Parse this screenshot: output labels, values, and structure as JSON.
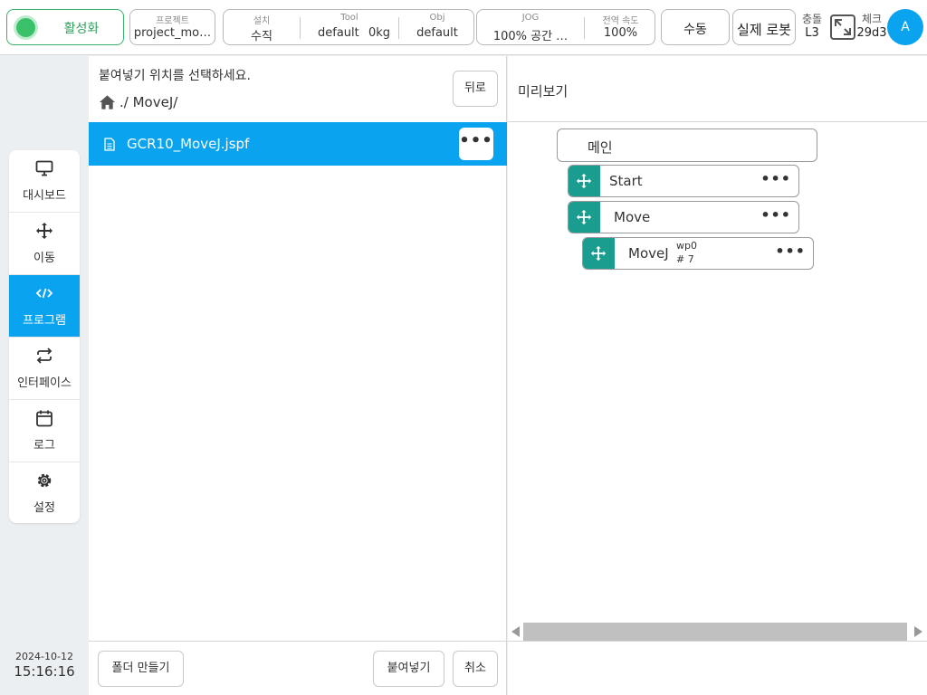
{
  "topbar": {
    "status_label": "활성화",
    "project": {
      "label": "프로젝트",
      "value": "project_mo…"
    },
    "install": {
      "label": "설치",
      "value": "수직"
    },
    "tool": {
      "label": "Tool",
      "value_name": "default",
      "value_weight": "0kg"
    },
    "obj": {
      "label": "Obj",
      "value": "default"
    },
    "jog": {
      "label": "JOG",
      "value": "100%  공간 …"
    },
    "global_speed": {
      "label": "전역 속도",
      "value": "100%"
    },
    "manual_label": "수동",
    "real_robot_label": "실제 로봇",
    "collision": {
      "label": "충돌",
      "value": "L3"
    },
    "check": {
      "label": "체크",
      "value": "29d3"
    },
    "avatar_letter": "A"
  },
  "sidenav": {
    "items": [
      {
        "label": "대시보드",
        "icon": "monitor-icon"
      },
      {
        "label": "이동",
        "icon": "move-icon"
      },
      {
        "label": "프로그램",
        "icon": "code-icon"
      },
      {
        "label": "인터페이스",
        "icon": "swap-icon"
      },
      {
        "label": "로그",
        "icon": "calendar-icon"
      },
      {
        "label": "설정",
        "icon": "gear-icon"
      }
    ],
    "active_index": 2
  },
  "clock": {
    "date": "2024-10-12",
    "time": "15:16:16"
  },
  "left_panel": {
    "prompt": "붙여넣기 위치를 선택하세요.",
    "breadcrumb": "./ MoveJ/",
    "back_label": "뒤로",
    "files": [
      {
        "name": "GCR10_MoveJ.jspf",
        "more": "•••"
      }
    ],
    "create_folder_label": "폴더 만들기",
    "paste_label": "붙여넣기",
    "cancel_label": "취소"
  },
  "preview": {
    "title": "미리보기",
    "main_label": "메인",
    "nodes": [
      {
        "label": "Start",
        "more": "•••"
      },
      {
        "label": "Move",
        "more": "•••"
      },
      {
        "label": "MoveJ",
        "sup_top": "wp0",
        "sup_bottom": "# 7",
        "more": "•••"
      }
    ]
  },
  "colors": {
    "accent": "#0aa3f0",
    "active_green": "#3cc16b",
    "node_handle": "#1a9c8e"
  }
}
